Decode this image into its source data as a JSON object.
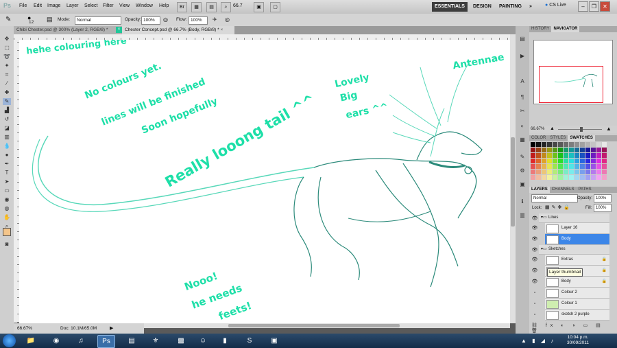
{
  "app": {
    "logo": "Ps",
    "menus": [
      "File",
      "Edit",
      "Image",
      "Layer",
      "Select",
      "Filter",
      "View",
      "Window",
      "Help"
    ],
    "zoom_field": "66.7",
    "workspaces": [
      "ESSENTIALS",
      "DESIGN",
      "PAINTING",
      "»"
    ],
    "cs_live": "CS Live",
    "window_controls": [
      "–",
      "❐",
      "✕"
    ]
  },
  "options_bar": {
    "brush_size": "12",
    "mode_label": "Mode:",
    "mode_value": "Normal",
    "opacity_label": "Opacity:",
    "opacity_value": "100%",
    "flow_label": "Flow:",
    "flow_value": "100%"
  },
  "tabs": [
    {
      "label": "Chibi Chester.psd @ 300% (Layer 2, RGB/8) *"
    },
    {
      "label": "Chester Concept.psd @ 66.7% (Body, RGB/8) *"
    }
  ],
  "status": {
    "zoom": "66.67%",
    "doc": "Doc: 10.1M/65.0M"
  },
  "canvas_notes": {
    "note1": "hehe colouring here",
    "note2a": "No colours yet.",
    "note2b": "lines will be finished",
    "note2c": "Soon hopefully",
    "note3": "Really looong tail ^^",
    "note4a": "Lovely",
    "note4b": "Big",
    "note4c": "ears ^^",
    "note5": "Antennae",
    "note6a": "Nooo!",
    "note6b": "he needs",
    "note6c": "feets!"
  },
  "panels": {
    "history_tab": "HISTORY",
    "navigator_tab": "NAVIGATOR",
    "navigator_zoom": "66.67%",
    "color_tabs": [
      "COLOR",
      "STYLES",
      "SWATCHES"
    ],
    "layer_tabs": [
      "LAYERS",
      "CHANNELS",
      "PATHS"
    ],
    "blend_mode": "Normal",
    "opacity_label": "Opacity:",
    "opacity_value": "100%",
    "lock_label": "Lock:",
    "fill_label": "Fill:",
    "fill_value": "100%"
  },
  "layers": [
    {
      "name": "Lines",
      "type": "group"
    },
    {
      "name": "Layer 16",
      "type": "layer"
    },
    {
      "name": "Body",
      "type": "layer",
      "selected": true
    },
    {
      "name": "Sketches",
      "type": "group"
    },
    {
      "name": "Extras",
      "type": "layer",
      "locked": true
    },
    {
      "name": "Layer thumbnail",
      "type": "tooltip"
    },
    {
      "name": "Body",
      "type": "layer",
      "locked": true
    },
    {
      "name": "Colour 2",
      "type": "layer"
    },
    {
      "name": "Colour 1",
      "type": "layer"
    },
    {
      "name": "sketch 2 purple",
      "type": "layer"
    }
  ],
  "tooltip": "Layer thumbnail",
  "taskbar": {
    "time": "10:04 p.m.",
    "date": "30/09/2011"
  },
  "colors": {
    "ink": "#1edfa8",
    "selected_layer": "#3c86e8"
  }
}
